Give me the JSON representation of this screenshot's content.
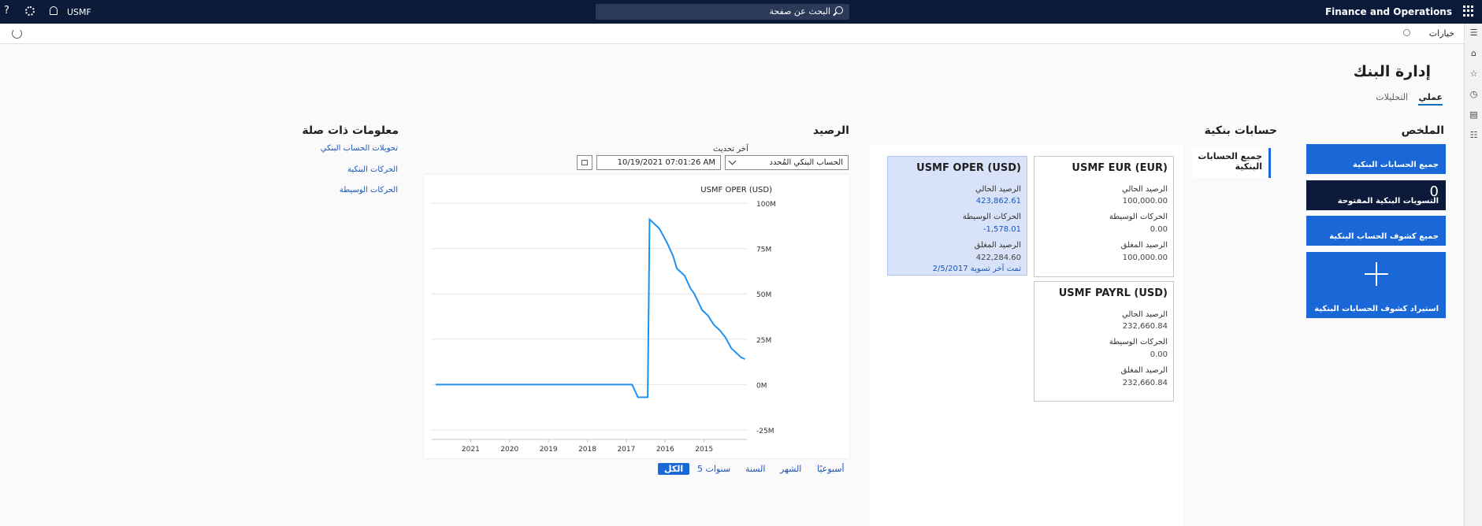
{
  "topbar": {
    "app_title": "Finance and Operations",
    "search_placeholder": "البحث عن صفحة",
    "company": "USMF",
    "help_glyph": "?"
  },
  "actionbar": {
    "options_label": "خيارات"
  },
  "page": {
    "title": "إدارة البنك",
    "tabs": [
      {
        "label": "عملي",
        "active": true
      },
      {
        "label": "التحليلات",
        "active": false
      }
    ]
  },
  "summary": {
    "title": "الملخص",
    "tiles": [
      {
        "label": "جميع الحسابات البنكية"
      },
      {
        "label": "التسويات البنكية المفتوحة",
        "count": "0"
      },
      {
        "label": "جميع كشوف الحساب البنكية"
      },
      {
        "label": "استيراد كشوف الحسابات البنكية",
        "icon": "plus-icon"
      }
    ]
  },
  "bank_accounts": {
    "title": "حسابات بنكية",
    "side_tab": "جميع الحسابات البنكية",
    "accounts": [
      {
        "name": "USMF EUR (EUR)",
        "current_label": "الرصيد الحالي",
        "current": "100,000.00",
        "intermediate_label": "الحركات الوسيطة",
        "intermediate": "0.00",
        "closing_label": "الرصيد المغلق",
        "closing": "100,000.00",
        "footer": ""
      },
      {
        "name": "USMF OPER (USD)",
        "current_label": "الرصيد الحالي",
        "current": "423,862.61",
        "intermediate_label": "الحركات الوسيطة",
        "intermediate": "-1,578.01",
        "closing_label": "الرصيد المغلق",
        "closing": "422,284.60",
        "footer": "تمت آخر تسوية 2/5/2017"
      },
      {
        "name": "USMF PAYRL (USD)",
        "current_label": "الرصيد الحالي",
        "current": "232,660.84",
        "intermediate_label": "الحركات الوسيطة",
        "intermediate": "0.00",
        "closing_label": "الرصيد المغلق",
        "closing": "232,660.84",
        "footer": ""
      }
    ]
  },
  "balance": {
    "title": "الرصيد",
    "account_select": "الحساب البنكي المُحدد",
    "last_update_label": "آخر تحديث",
    "last_update_value": "10/19/2021 07:01:26 AM",
    "periods": [
      "أسبوعيًا",
      "الشهر",
      "السنة",
      "5 سنوات",
      "الكل"
    ],
    "active_period": "الكل"
  },
  "related": {
    "title": "معلومات ذات صلة",
    "links": [
      "تحويلات الحساب البنكي",
      "الحركات البنكية",
      "الحركات الوسيطة"
    ]
  },
  "chart_data": {
    "type": "line",
    "title": "USMF OPER (USD)",
    "series": [
      {
        "name": "USMF OPER (USD)",
        "color": "#1e90ef"
      }
    ],
    "x_tick_labels": [
      "2021",
      "2020",
      "2019",
      "2018",
      "2017",
      "2016",
      "2015"
    ],
    "y_tick_labels": [
      "100M",
      "75M",
      "50M",
      "25M",
      "0M",
      "-25M"
    ],
    "ylim": [
      -25,
      100
    ],
    "y_unit": "M",
    "x_direction": "right-to-left",
    "grid": true,
    "points": [
      {
        "x": 2021.9,
        "y": 0
      },
      {
        "x": 2016.85,
        "y": 0
      },
      {
        "x": 2016.7,
        "y": -7
      },
      {
        "x": 2016.45,
        "y": -7
      },
      {
        "x": 2016.4,
        "y": 91
      },
      {
        "x": 2016.15,
        "y": 86
      },
      {
        "x": 2015.95,
        "y": 78
      },
      {
        "x": 2015.8,
        "y": 71
      },
      {
        "x": 2015.7,
        "y": 64
      },
      {
        "x": 2015.5,
        "y": 60
      },
      {
        "x": 2015.35,
        "y": 53
      },
      {
        "x": 2015.25,
        "y": 50
      },
      {
        "x": 2015.05,
        "y": 41
      },
      {
        "x": 2014.9,
        "y": 38
      },
      {
        "x": 2014.75,
        "y": 33
      },
      {
        "x": 2014.6,
        "y": 30
      },
      {
        "x": 2014.45,
        "y": 26
      },
      {
        "x": 2014.3,
        "y": 20
      },
      {
        "x": 2014.05,
        "y": 15
      },
      {
        "x": 2013.95,
        "y": 14
      }
    ]
  }
}
